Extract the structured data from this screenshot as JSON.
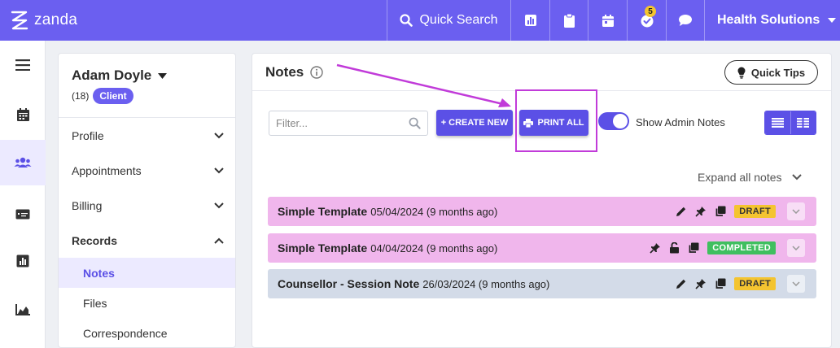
{
  "app": {
    "logo_text": "zanda"
  },
  "topbar": {
    "search_label": "Quick Search",
    "tasks_badge": "5",
    "org_name": "Health Solutions",
    "icons": [
      "chart-icon",
      "clipboard-icon",
      "calendar-icon",
      "tasks-check-icon",
      "chat-icon"
    ]
  },
  "rail": {
    "items": [
      "menu-icon",
      "calendar-icon",
      "clients-icon",
      "billing-card-icon",
      "reports-icon",
      "analytics-icon"
    ]
  },
  "client": {
    "name": "Adam Doyle",
    "count": "(18)",
    "type_badge": "Client",
    "menu": [
      {
        "label": "Profile"
      },
      {
        "label": "Appointments"
      },
      {
        "label": "Billing"
      },
      {
        "label": "Records"
      }
    ],
    "sub_menu": [
      {
        "label": "Notes"
      },
      {
        "label": "Files"
      },
      {
        "label": "Correspondence"
      }
    ]
  },
  "notes": {
    "title": "Notes",
    "quick_tips_label": "Quick Tips",
    "filter_placeholder": "Filter...",
    "create_new_label": "+ CREATE NEW",
    "print_all_label": "PRINT ALL",
    "show_admin_label": "Show Admin Notes",
    "show_admin_on": true,
    "expand_label": "Expand all notes",
    "rows": [
      {
        "title": "Simple Template",
        "date": "05/04/2024 (9 months ago)",
        "status": "DRAFT"
      },
      {
        "title": "Simple Template",
        "date": "04/04/2024 (9 months ago)",
        "status": "COMPLETED"
      },
      {
        "title": "Counsellor - Session Note",
        "date": "26/03/2024 (9 months ago)",
        "status": "DRAFT"
      }
    ]
  },
  "colors": {
    "brand": "#6b5ff0",
    "primary_button": "#5b50e6",
    "row_pink": "#f0b6ec",
    "row_blue": "#d3dbe8",
    "draft": "#f4c430",
    "completed": "#3fbf5f",
    "annotation": "#c13bd9"
  }
}
